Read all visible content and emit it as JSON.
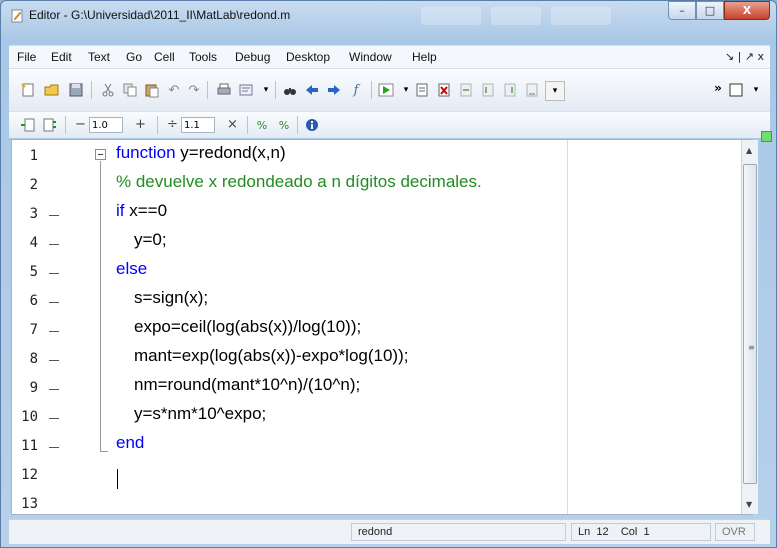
{
  "window": {
    "title": "Editor - G:\\Universidad\\2011_II\\MatLab\\redond.m",
    "buttons": {
      "minimize": "–",
      "maximize": "□",
      "close": "X"
    }
  },
  "menu": {
    "items": [
      "File",
      "Edit",
      "Text",
      "Go",
      "Cell",
      "Tools",
      "Debug",
      "Desktop",
      "Window",
      "Help"
    ],
    "right": "↘ | ↗ x"
  },
  "toolbar2": {
    "minus": "−",
    "value1": "1.0",
    "plus": "+",
    "divide": "÷",
    "value2": "1.1",
    "times": "×"
  },
  "editor": {
    "line_numbers": [
      "1",
      "2",
      "3",
      "4",
      "5",
      "6",
      "7",
      "8",
      "9",
      "10",
      "11",
      "12",
      "13"
    ],
    "code": {
      "l1_kw": "function",
      "l1_rest": " y=redond(x,n)",
      "l2": "% devuelve x redondeado a n dígitos decimales.",
      "l3_kw": "if",
      "l3_rest": " x==0",
      "l4": "y=0;",
      "l5": "else",
      "l6": "s=sign(x);",
      "l7": "expo=ceil(log(abs(x))/log(10));",
      "l8": "mant=exp(log(abs(x))-expo*log(10));",
      "l9": "nm=round(mant*10^n)/(10^n);",
      "l10": "y=s*nm*10^expo;",
      "l11": "end"
    }
  },
  "status": {
    "function": "redond",
    "ln_label": "Ln",
    "ln_value": "12",
    "col_label": "Col",
    "col_value": "1",
    "mode": "OVR"
  },
  "colors": {
    "keyword": "#0000ff",
    "comment": "#228b22"
  }
}
